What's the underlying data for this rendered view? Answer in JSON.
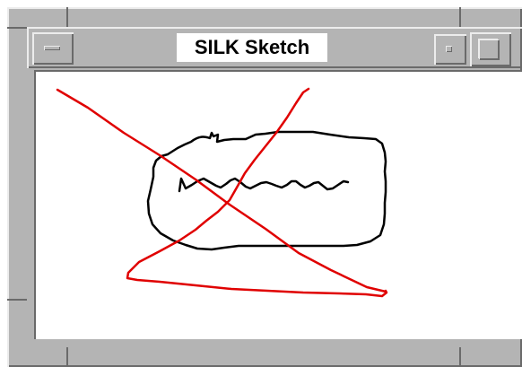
{
  "window": {
    "title": "SILK Sketch",
    "frame_color": "#b4b4b4",
    "highlight_color": "#ececec",
    "shadow_color": "#6a6a6a"
  },
  "titlebar": {
    "menu_button_icon": "window-menu-icon",
    "minimize_button_icon": "minimize-icon",
    "maximize_button_icon": "maximize-icon"
  },
  "sketch": {
    "background": "#ffffff",
    "ink_colors": {
      "sketch": "#000000",
      "gesture": "#e00000"
    },
    "strokes": [
      {
        "name": "rounded-rectangle",
        "color": "black"
      },
      {
        "name": "squiggle",
        "color": "black"
      },
      {
        "name": "delete-gesture-diagonal",
        "color": "red"
      },
      {
        "name": "delete-gesture-loop",
        "color": "red"
      }
    ]
  }
}
